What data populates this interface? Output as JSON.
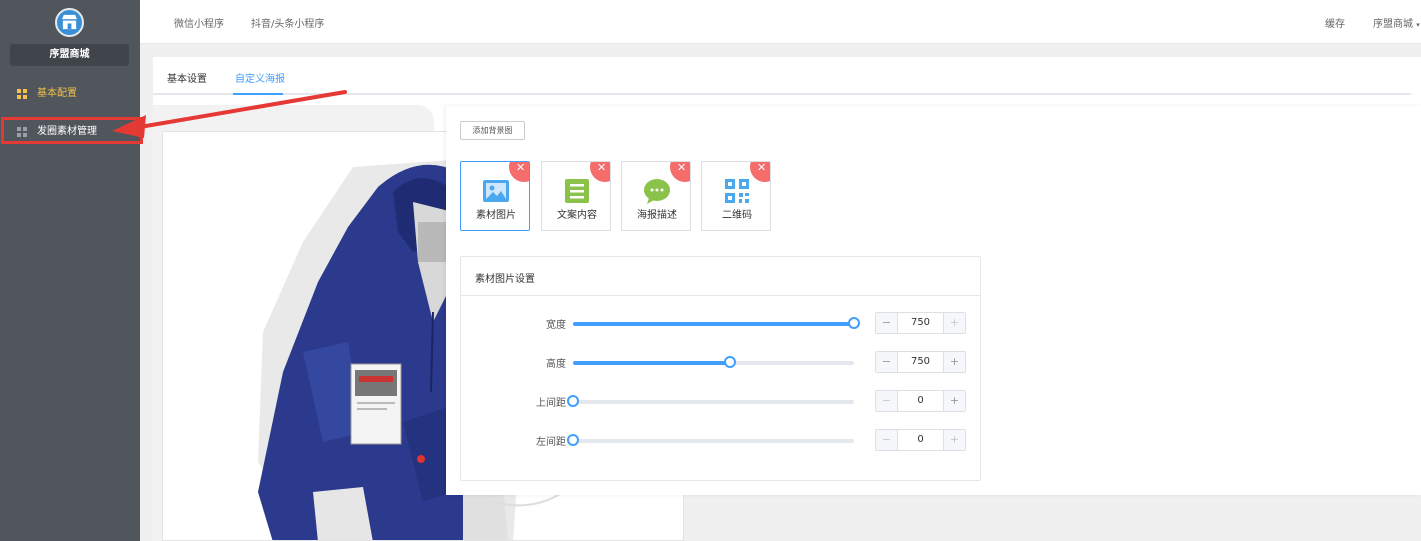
{
  "sidebar": {
    "shop_name": "序盟商城",
    "items": [
      {
        "label": "基本配置",
        "icon": "grid-icon"
      },
      {
        "label": "发圈素材管理",
        "icon": "grid-icon"
      }
    ]
  },
  "topbar": {
    "tabs": [
      "微信小程序",
      "抖音/头条小程序"
    ],
    "cache_label": "缓存",
    "account_label": "序盟商城"
  },
  "page_tabs": [
    "基本设置",
    "自定义海报"
  ],
  "active_tab": "自定义海报",
  "editor": {
    "add_background_button": "添加背景图",
    "tools": [
      {
        "label": "素材图片",
        "icon": "image-icon",
        "color": "#4aa8f0"
      },
      {
        "label": "文案内容",
        "icon": "document-icon",
        "color": "#8bc34a"
      },
      {
        "label": "海报描述",
        "icon": "chat-bubble-icon",
        "color": "#8bc34a"
      },
      {
        "label": "二维码",
        "icon": "qrcode-icon",
        "color": "#4aa8f0"
      }
    ],
    "settings_title": "素材图片设置",
    "settings": [
      {
        "label": "宽度",
        "value": "750",
        "fraction": 1.0
      },
      {
        "label": "高度",
        "value": "750",
        "fraction": 0.56
      },
      {
        "label": "上间距",
        "value": "0",
        "fraction": 0.0
      },
      {
        "label": "左间距",
        "value": "0",
        "fraction": 0.0
      }
    ]
  },
  "colors": {
    "accent": "#409eff",
    "sidebar_bg": "#50565c",
    "active_menu": "#f0c14b",
    "annotation_red": "#e53935",
    "delete_badge": "#f56c6c"
  }
}
